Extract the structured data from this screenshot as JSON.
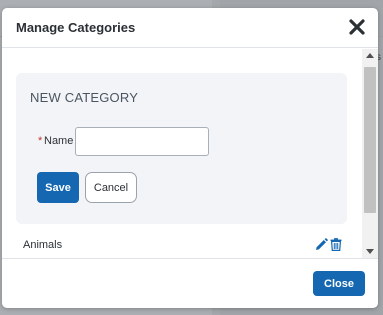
{
  "background": {
    "ghost_char": "s"
  },
  "modal": {
    "title": "Manage Categories",
    "close_icon": "close-x-icon"
  },
  "new_category": {
    "heading": "NEW CATEGORY",
    "required_marker": "*",
    "name_label": "Name",
    "name_value": "",
    "name_placeholder": "",
    "save_label": "Save",
    "cancel_label": "Cancel"
  },
  "categories": [
    {
      "name": "Animals",
      "edit_icon": "pencil-icon",
      "delete_icon": "trash-icon"
    }
  ],
  "footer": {
    "close_label": "Close"
  },
  "colors": {
    "primary": "#1467b0",
    "required": "#c4302b",
    "card_bg": "#f3f4f7",
    "overlay": "#a9acb0"
  }
}
